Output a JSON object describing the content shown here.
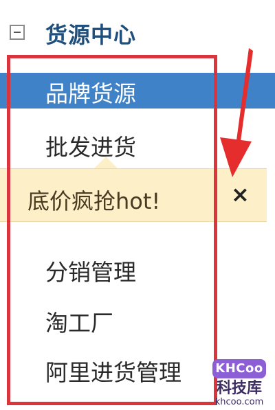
{
  "section": {
    "title": "货源中心",
    "collapse_icon": "minus-box-icon"
  },
  "menu": {
    "items": [
      {
        "label": "品牌货源",
        "selected": true
      },
      {
        "label": "批发进货"
      },
      {
        "label": "分销管理"
      },
      {
        "label": "淘工厂"
      },
      {
        "label": "阿里进货管理"
      }
    ]
  },
  "tooltip": {
    "text": "底价疯抢hot!",
    "close_label": "×"
  },
  "annotation": {
    "frame_color": "#d9353c",
    "arrow_color": "#e52d2d"
  },
  "watermark": {
    "logo": "KHCoo",
    "cn": "科技库",
    "url": "khcoo.com"
  },
  "colors": {
    "accent": "#3f82c7",
    "title": "#1f4f7a",
    "tooltip_bg": "#fdf0c9"
  }
}
